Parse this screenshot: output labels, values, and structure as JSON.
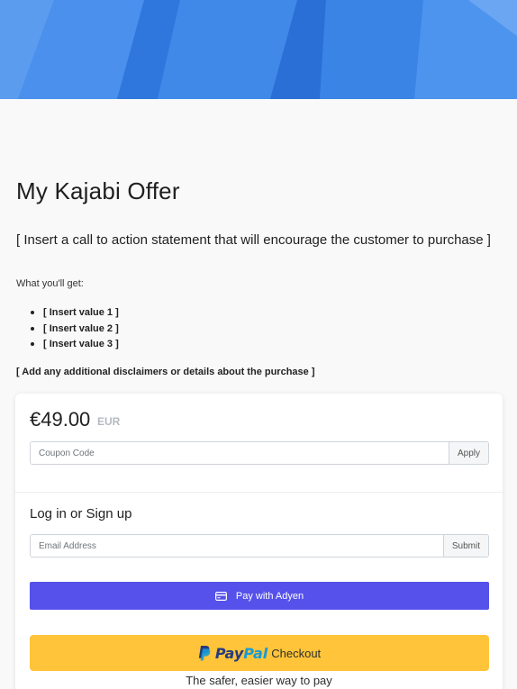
{
  "offer": {
    "title": "My Kajabi Offer",
    "cta": "[ Insert a call to action statement that will encourage the customer to purchase ]",
    "what_youll_get": "What you'll get:",
    "values": [
      "[ Insert value 1 ]",
      "[ Insert value 2 ]",
      "[ Insert value 3 ]"
    ],
    "disclaimer": "[ Add any additional disclaimers or details about the purchase ]"
  },
  "checkout": {
    "price": "€49.00",
    "currency": "EUR",
    "coupon_placeholder": "Coupon Code",
    "apply_label": "Apply",
    "login_heading": "Log in or Sign up",
    "email_placeholder": "Email Address",
    "submit_label": "Submit",
    "adyen_label": "Pay with Adyen",
    "paypal_pay": "Pay",
    "paypal_pal": "Pal",
    "paypal_checkout": "Checkout",
    "paypal_tagline": "The safer, easier way to pay"
  },
  "colors": {
    "hero": "#3b82e6",
    "adyen_button": "#5551ea",
    "paypal_button": "#ffc439",
    "paypal_dark_blue": "#253b80",
    "paypal_light_blue": "#179bd7"
  },
  "icons": {
    "adyen": "credit-card-icon",
    "paypal": "paypal-logo-icon"
  }
}
